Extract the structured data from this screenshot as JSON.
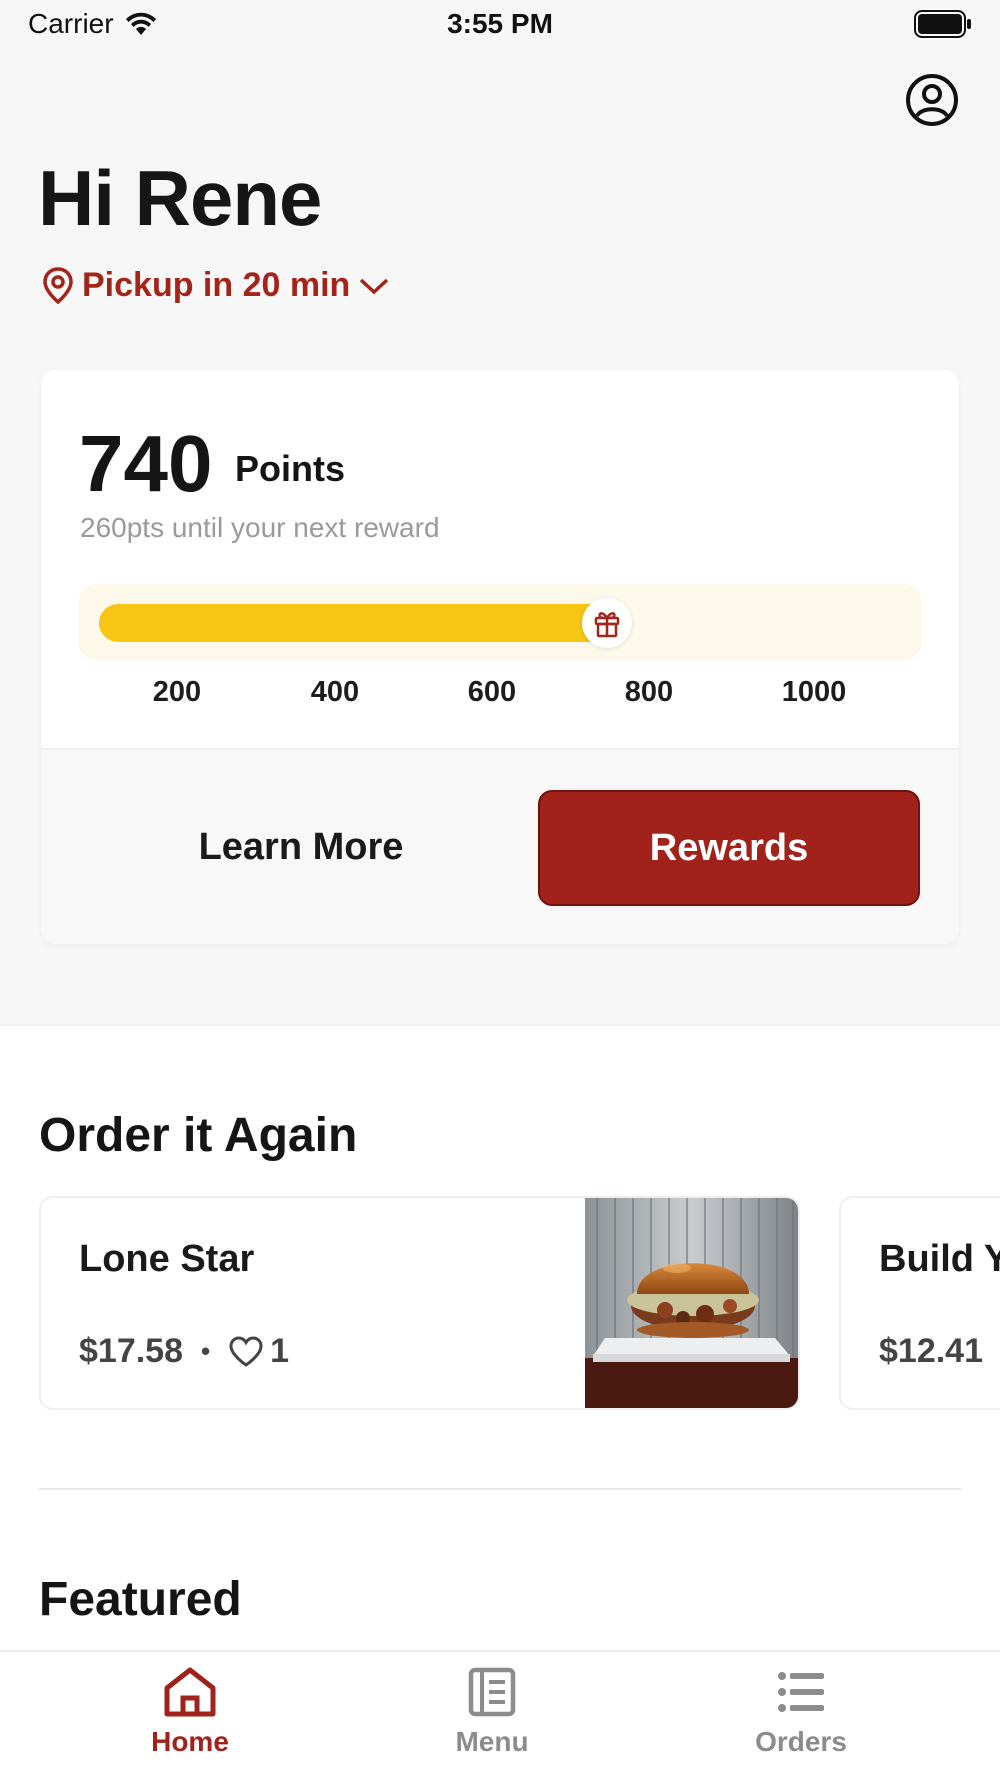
{
  "status_bar": {
    "carrier": "Carrier",
    "time": "3:55 PM"
  },
  "header": {
    "greeting": "Hi Rene",
    "pickup_label": "Pickup in 20 min"
  },
  "points_card": {
    "points": "740",
    "points_label": "Points",
    "subtitle": "260pts until your next reward",
    "progress_value": 740,
    "progress_max": 1000,
    "ticks": [
      "200",
      "400",
      "600",
      "800",
      "1000"
    ],
    "learn_more_label": "Learn More",
    "rewards_label": "Rewards"
  },
  "order_again": {
    "title": "Order it Again",
    "items": [
      {
        "name": "Lone Star",
        "price": "$17.58",
        "separator": "•",
        "likes": "1"
      },
      {
        "name": "Build Y",
        "price": "$12.41"
      }
    ]
  },
  "featured": {
    "title": "Featured"
  },
  "tab_bar": {
    "tabs": [
      {
        "label": "Home",
        "icon": "home-icon",
        "active": true
      },
      {
        "label": "Menu",
        "icon": "menu-book-icon",
        "active": false
      },
      {
        "label": "Orders",
        "icon": "list-icon",
        "active": false
      }
    ]
  },
  "colors": {
    "accent": "#a0221a",
    "progress": "#f7c514",
    "inactive_tab": "#8c8c8c"
  }
}
